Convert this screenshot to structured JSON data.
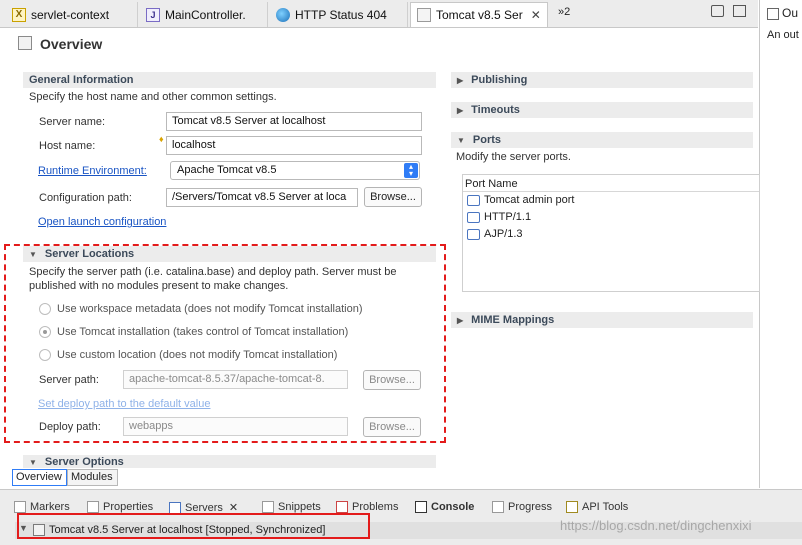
{
  "tabs": [
    {
      "label": "servlet-context",
      "icon": "xml-file-icon"
    },
    {
      "label": "MainController.",
      "icon": "java-file-icon"
    },
    {
      "label": "HTTP Status 404",
      "icon": "globe-icon"
    },
    {
      "label": "Tomcat v8.5 Ser",
      "icon": "server-icon",
      "active": true
    }
  ],
  "tab_overflow": "»2",
  "outline": {
    "title": "Ou",
    "text": "An out"
  },
  "editor": {
    "title": "Overview",
    "general": {
      "heading": "General Information",
      "description": "Specify the host name and other common settings.",
      "server_name_label": "Server name:",
      "server_name_value": "Tomcat v8.5 Server at localhost",
      "host_name_label": "Host name:",
      "host_name_value": "localhost",
      "runtime_label": "Runtime Environment:",
      "runtime_value": "Apache Tomcat v8.5",
      "config_path_label": "Configuration path:",
      "config_path_value": "/Servers/Tomcat v8.5 Server at loca",
      "browse_label": "Browse...",
      "launch_link": "Open launch configuration"
    },
    "server_locations": {
      "heading": "Server Locations",
      "description_line1": "Specify the server path (i.e. catalina.base) and deploy path. Server must be",
      "description_line2": "published with no modules present to make changes.",
      "options": [
        "Use workspace metadata (does not modify Tomcat installation)",
        "Use Tomcat installation (takes control of Tomcat installation)",
        "Use custom location (does not modify Tomcat installation)"
      ],
      "selected_option_index": 1,
      "server_path_label": "Server path:",
      "server_path_value": "apache-tomcat-8.5.37/apache-tomcat-8.",
      "browse_label": "Browse...",
      "default_deploy_link": "Set deploy path to the default value",
      "deploy_path_label": "Deploy path:",
      "deploy_path_value": "webapps"
    },
    "server_options_heading": "Server Options",
    "right": {
      "publishing": "Publishing",
      "timeouts": "Timeouts",
      "ports": "Ports",
      "ports_description": "Modify the server ports.",
      "port_name_header": "Port Name",
      "port_items": [
        "Tomcat admin port",
        "HTTP/1.1",
        "AJP/1.3"
      ],
      "mime": "MIME Mappings"
    },
    "bottom_tabs": [
      "Overview",
      "Modules"
    ]
  },
  "views": {
    "tabs": [
      "Markers",
      "Properties",
      "Servers",
      "Snippets",
      "Problems",
      "Console",
      "Progress",
      "API Tools"
    ],
    "active": "Servers",
    "server_entry": "Tomcat v8.5 Server at localhost  [Stopped, Synchronized]",
    "watermark": "https://blog.csdn.net/dingchenxixi"
  },
  "colors": {
    "highlight_box": "#e31b1b",
    "link": "#1a55c4",
    "accent": "#2f7cf6"
  }
}
